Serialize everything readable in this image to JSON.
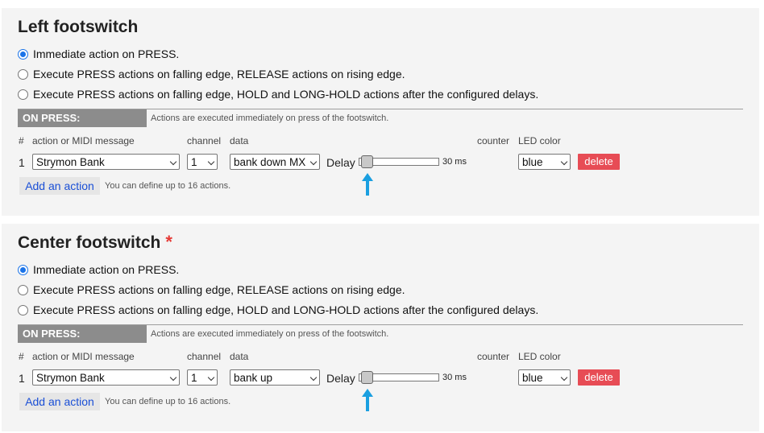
{
  "panels": [
    {
      "title": "Left footswitch",
      "required_star": "",
      "modes": [
        "Immediate action on PRESS.",
        "Execute PRESS actions on falling edge, RELEASE actions on rising edge.",
        "Execute PRESS actions on falling edge, HOLD and LONG-HOLD actions after the configured delays."
      ],
      "selected_mode": 0,
      "section_label": "ON PRESS:",
      "section_desc": "Actions are executed immediately on press of the footswitch.",
      "columns": {
        "num": "#",
        "action": "action or MIDI message",
        "channel": "channel",
        "data": "data",
        "counter": "counter",
        "led": "LED color"
      },
      "row": {
        "num": "1",
        "action": "Strymon Bank",
        "channel": "1",
        "data": "bank down MX",
        "delay_label": "Delay",
        "delay_value": "30 ms",
        "led": "blue",
        "delete_label": "delete"
      },
      "add_label": "Add an action",
      "add_note": "You can define up to 16 actions."
    },
    {
      "title": "Center footswitch",
      "required_star": "*",
      "modes": [
        "Immediate action on PRESS.",
        "Execute PRESS actions on falling edge, RELEASE actions on rising edge.",
        "Execute PRESS actions on falling edge, HOLD and LONG-HOLD actions after the configured delays."
      ],
      "selected_mode": 0,
      "section_label": "ON PRESS:",
      "section_desc": "Actions are executed immediately on press of the footswitch.",
      "columns": {
        "num": "#",
        "action": "action or MIDI message",
        "channel": "channel",
        "data": "data",
        "counter": "counter",
        "led": "LED color"
      },
      "row": {
        "num": "1",
        "action": "Strymon Bank",
        "channel": "1",
        "data": "bank up",
        "delay_label": "Delay",
        "delay_value": "30 ms",
        "led": "blue",
        "delete_label": "delete"
      },
      "add_label": "Add an action",
      "add_note": "You can define up to 16 actions."
    }
  ],
  "colors": {
    "accent": "#1a73e8",
    "delete": "#e74c55",
    "arrow": "#1a9fe0",
    "badge": "#8c8c8c"
  }
}
